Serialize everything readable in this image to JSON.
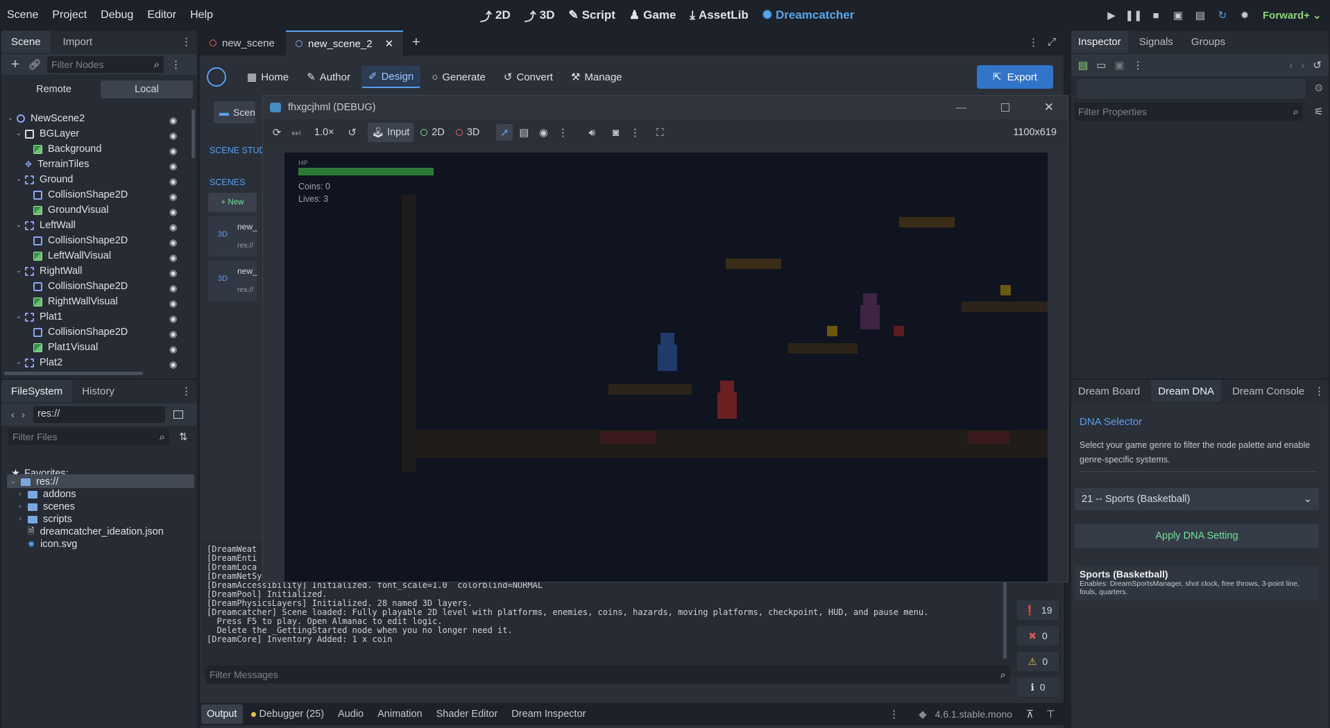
{
  "menu": [
    "Scene",
    "Project",
    "Debug",
    "Editor",
    "Help"
  ],
  "workspaces": [
    "2D",
    "3D",
    "Script",
    "Game",
    "AssetLib",
    "Dreamcatcher"
  ],
  "renderer": "Forward+",
  "scene_dock": {
    "tabs": [
      "Scene",
      "Import"
    ],
    "filter_placeholder": "Filter Nodes",
    "remote_label": "Remote",
    "local_label": "Local",
    "tree": [
      {
        "name": "NewScene2",
        "depth": 0,
        "icon": "node2d",
        "expanded": true
      },
      {
        "name": "BGLayer",
        "depth": 1,
        "icon": "canvas-layer",
        "expanded": true
      },
      {
        "name": "Background",
        "depth": 2,
        "icon": "sprite"
      },
      {
        "name": "TerrainTiles",
        "depth": 1,
        "icon": "tilemap"
      },
      {
        "name": "Ground",
        "depth": 1,
        "icon": "body",
        "expanded": true
      },
      {
        "name": "CollisionShape2D",
        "depth": 2,
        "icon": "shape"
      },
      {
        "name": "GroundVisual",
        "depth": 2,
        "icon": "sprite"
      },
      {
        "name": "LeftWall",
        "depth": 1,
        "icon": "body",
        "expanded": true
      },
      {
        "name": "CollisionShape2D",
        "depth": 2,
        "icon": "shape"
      },
      {
        "name": "LeftWallVisual",
        "depth": 2,
        "icon": "sprite"
      },
      {
        "name": "RightWall",
        "depth": 1,
        "icon": "body",
        "expanded": true
      },
      {
        "name": "CollisionShape2D",
        "depth": 2,
        "icon": "shape"
      },
      {
        "name": "RightWallVisual",
        "depth": 2,
        "icon": "sprite"
      },
      {
        "name": "Plat1",
        "depth": 1,
        "icon": "body",
        "expanded": true
      },
      {
        "name": "CollisionShape2D",
        "depth": 2,
        "icon": "shape"
      },
      {
        "name": "Plat1Visual",
        "depth": 2,
        "icon": "sprite"
      },
      {
        "name": "Plat2",
        "depth": 1,
        "icon": "body",
        "expanded": true
      }
    ]
  },
  "filesystem": {
    "tabs": [
      "FileSystem",
      "History"
    ],
    "path": "res://",
    "filter_placeholder": "Filter Files",
    "favorites_label": "Favorites:",
    "items": [
      {
        "name": "res://",
        "type": "root"
      },
      {
        "name": "addons",
        "type": "folder"
      },
      {
        "name": "scenes",
        "type": "folder"
      },
      {
        "name": "scripts",
        "type": "folder"
      },
      {
        "name": "dreamcatcher_ideation.json",
        "type": "file"
      },
      {
        "name": "icon.svg",
        "type": "image"
      }
    ]
  },
  "scene_tabs": [
    "new_scene",
    "new_scene_2"
  ],
  "plugin_toolbar": {
    "buttons": [
      "Home",
      "Author",
      "Design",
      "Generate",
      "Convert",
      "Manage"
    ],
    "active": "Design",
    "export_label": "Export"
  },
  "behind": {
    "scene_btn": "Scen",
    "scene_studio": "SCENE STUD",
    "scenes_tab": "SCENES",
    "new_btn": "+ New",
    "cards": [
      {
        "badge": "3D",
        "title": "new_",
        "path": "res://"
      },
      {
        "badge": "3D",
        "title": "new_",
        "path": "res://"
      }
    ]
  },
  "game_window": {
    "title": "fhxgcjhml (DEBUG)",
    "speed": "1.0×",
    "input_label": "Input",
    "mode_2d": "2D",
    "mode_3d": "3D",
    "resolution": "1100x619",
    "hud": {
      "hp_label": "HP",
      "hp": 1.0,
      "coins": "Coins: 0",
      "lives": "Lives: 3"
    }
  },
  "output": {
    "lines": [
      "[DreamWeat",
      "[DreamEnti",
      "[DreamLoca",
      "[DreamNetSync] Initialized. Transport: ENET",
      "[DreamAccessibility] Initialized. font_scale=1.0  colorblind=NORMAL",
      "[DreamPool] Initialized.",
      "[DreamPhysicsLayers] Initialized. 28 named 3D layers.",
      "[Dreamcatcher] Scene loaded: Fully playable 2D level with platforms, enemies, coins, hazards, moving platforms, checkpoint, HUD, and pause menu.",
      "  Press F5 to play. Open Almanac to edit logic.",
      "  Delete the _GettingStarted node when you no longer need it.",
      "[DreamCore] Inventory Added: 1 x coin"
    ],
    "filter_placeholder": "Filter Messages",
    "counts": {
      "messages": "19",
      "errors": "0",
      "warnings": "0",
      "info": "0"
    }
  },
  "bottom_tabs": [
    "Output",
    "Debugger (25)",
    "Audio",
    "Animation",
    "Shader Editor",
    "Dream Inspector"
  ],
  "version": "4.6.1.stable.mono",
  "inspector": {
    "tabs": [
      "Inspector",
      "Signals",
      "Groups"
    ],
    "filter_placeholder": "Filter Properties"
  },
  "dream_panel": {
    "tabs": [
      "Dream Board",
      "Dream DNA",
      "Dream Console"
    ],
    "title": "DNA Selector",
    "description": "Select your game genre to filter the node palette and enable genre-specific systems.",
    "selected_genre": "21 -- Sports (Basketball)",
    "apply_label": "Apply DNA Setting",
    "info_title": "Sports (Basketball)",
    "info_text": "Enables: DreamSportsManager, shot clock, free throws, 3-point line, fouls, quarters."
  },
  "colors": {
    "accent": "#5aa0ef",
    "bg": "#1d2129",
    "panel": "#262b34",
    "game_bg": "#0f1420",
    "green": "#6fe09a"
  }
}
